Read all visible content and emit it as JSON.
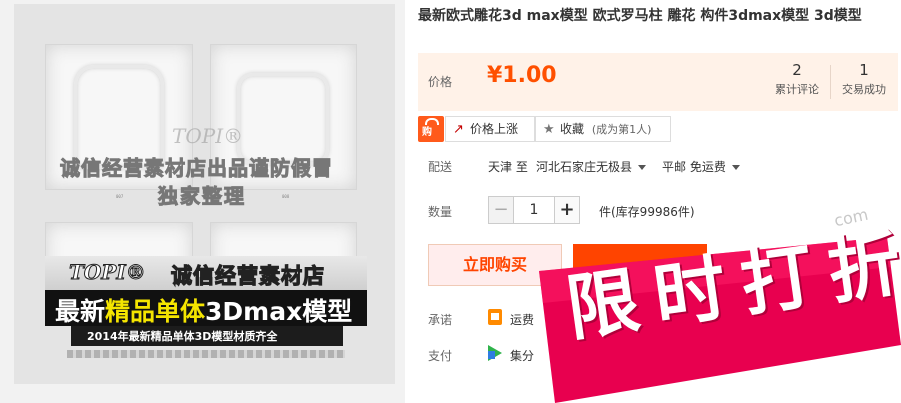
{
  "product": {
    "title": "最新欧式雕花3d max模型 欧式罗马柱 雕花 构件3dmax模型 3d模型"
  },
  "image": {
    "watermark_brand": "TOPI®",
    "watermark_line": "诚信经营素材店出品谨防假冒",
    "watermark_line2": "独家整理",
    "tile_caption_left": "007",
    "tile_caption_right": "008",
    "banner_brand": "TOPI®",
    "banner_store": "诚信经营素材店",
    "banner_main_prefix": "最新",
    "banner_main_highlight": "精品单体",
    "banner_main_suffix": "3Dmax模型",
    "banner_sub": "2014年最新精品单体3D模型材质齐全"
  },
  "price": {
    "label": "价格",
    "value": "¥1.00",
    "reviews_count": "2",
    "reviews_label": "累计评论",
    "deals_count": "1",
    "deals_label": "交易成功"
  },
  "actions": {
    "promo_badge": "购",
    "price_alert_label": "价格上涨",
    "favorite_label": "收藏",
    "favorite_note": "(成为第1人)"
  },
  "shipping": {
    "label": "配送",
    "from": "天津 至",
    "to": "河北石家庄无极县",
    "method": "平邮 免运费"
  },
  "quantity": {
    "label": "数量",
    "minus": "−",
    "value": "1",
    "plus": "+",
    "stock": "件(库存99986件)"
  },
  "buttons": {
    "buy_now": "立即购买"
  },
  "promise": {
    "label": "承诺",
    "text": "运费"
  },
  "payment": {
    "label": "支付",
    "text": "集分"
  },
  "sticker": {
    "text": "限时打折",
    "url_watermark": "com"
  },
  "colors": {
    "accent": "#ff5000",
    "price_bg": "#fff2e8",
    "sticker": "#e8004f"
  }
}
